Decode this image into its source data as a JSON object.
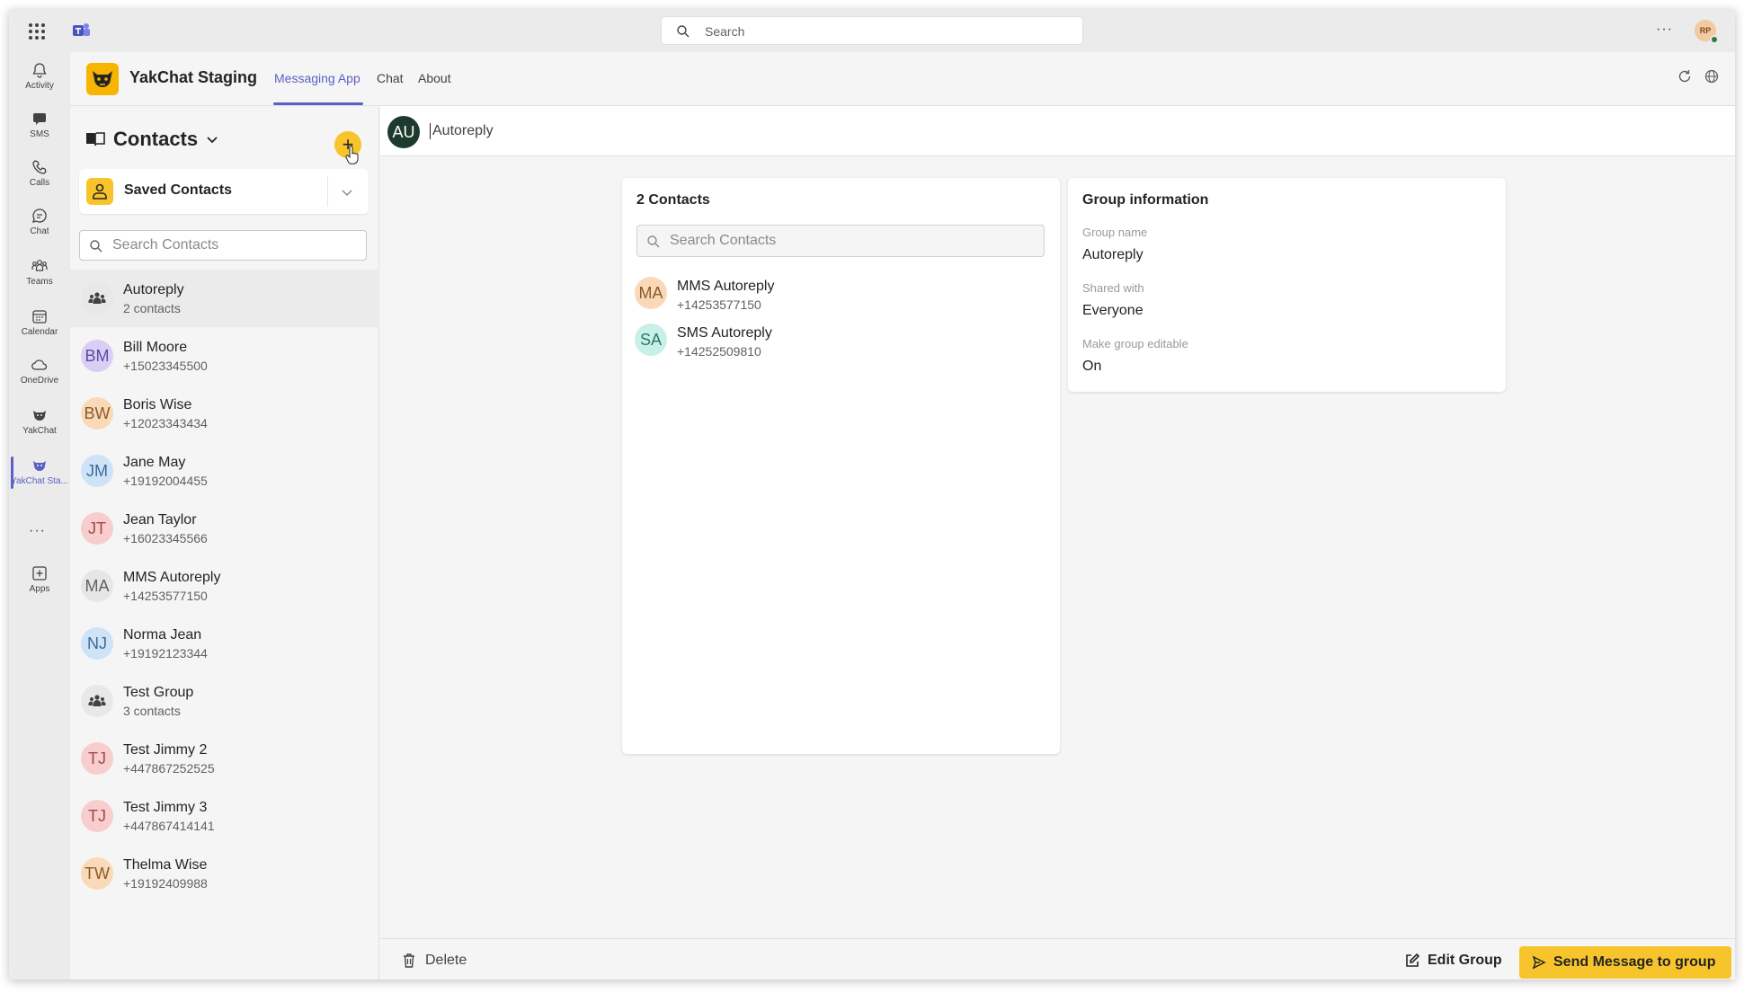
{
  "topbar": {
    "search_placeholder": "Search",
    "more": "···",
    "user_initials": "RP"
  },
  "rail": {
    "items": [
      {
        "label": "Activity",
        "icon": "bell-icon"
      },
      {
        "label": "SMS",
        "icon": "sms-icon"
      },
      {
        "label": "Calls",
        "icon": "phone-icon"
      },
      {
        "label": "Chat",
        "icon": "chat-icon"
      },
      {
        "label": "Teams",
        "icon": "teams-icon"
      },
      {
        "label": "Calendar",
        "icon": "calendar-icon"
      },
      {
        "label": "OneDrive",
        "icon": "cloud-icon"
      },
      {
        "label": "YakChat",
        "icon": "yakchat-icon"
      },
      {
        "label": "YakChat Sta...",
        "icon": "yakchat-staging-icon"
      },
      {
        "label": "Apps",
        "icon": "add-app-icon"
      }
    ],
    "more": "···",
    "accent": "#5b5fc7"
  },
  "app": {
    "title": "YakChat Staging",
    "tabs": [
      "Messaging App",
      "Chat",
      "About"
    ],
    "active_tab": "Messaging App",
    "brand_color": "#f7b500"
  },
  "contacts": {
    "title": "Contacts",
    "add_label": "+",
    "saved_label": "Saved Contacts",
    "search_placeholder": "Search Contacts",
    "items": [
      {
        "name": "Autoreply",
        "sub": "2 contacts",
        "initials": "",
        "group": true,
        "color": "#e8e8e8",
        "text_color": "#424242"
      },
      {
        "name": "Bill Moore",
        "sub": "+15023345500",
        "initials": "BM",
        "color": "#d9cff5",
        "text_color": "#5b4aa0"
      },
      {
        "name": "Boris Wise",
        "sub": "+12023343434",
        "initials": "BW",
        "color": "#f9d9b7",
        "text_color": "#8a5a2a"
      },
      {
        "name": "Jane May",
        "sub": "+19192004455",
        "initials": "JM",
        "color": "#cfe3f7",
        "text_color": "#3a6a9a"
      },
      {
        "name": "Jean Taylor",
        "sub": "+16023345566",
        "initials": "JT",
        "color": "#f7cdcd",
        "text_color": "#a04848"
      },
      {
        "name": "MMS Autoreply",
        "sub": "+14253577150",
        "initials": "MA",
        "color": "#e6e6e6",
        "text_color": "#616161"
      },
      {
        "name": "Norma Jean",
        "sub": "+19192123344",
        "initials": "NJ",
        "color": "#cfe3f7",
        "text_color": "#3a6a9a"
      },
      {
        "name": "Test Group",
        "sub": "3 contacts",
        "initials": "",
        "group": true,
        "color": "#e8e8e8",
        "text_color": "#424242"
      },
      {
        "name": "Test Jimmy 2",
        "sub": "+447867252525",
        "initials": "TJ",
        "color": "#f7cdcd",
        "text_color": "#a04848"
      },
      {
        "name": "Test Jimmy 3",
        "sub": "+447867414141",
        "initials": "TJ",
        "color": "#f7cdcd",
        "text_color": "#a04848"
      },
      {
        "name": "Thelma Wise",
        "sub": "+19192409988",
        "initials": "TW",
        "color": "#f9d9b7",
        "text_color": "#8a5a2a"
      }
    ]
  },
  "main": {
    "header": {
      "initials": "AU",
      "name": "Autoreply"
    },
    "members": {
      "title": "2 Contacts",
      "search_placeholder": "Search Contacts",
      "items": [
        {
          "name": "MMS Autoreply",
          "phone": "+14253577150",
          "initials": "MA",
          "color": "#f9d9b7",
          "text_color": "#8a5a2a"
        },
        {
          "name": "SMS Autoreply",
          "phone": "+14252509810",
          "initials": "SA",
          "color": "#c9efe9",
          "text_color": "#2a7a6a"
        }
      ]
    },
    "info": {
      "title": "Group information",
      "group_name_label": "Group name",
      "group_name": "Autoreply",
      "shared_label": "Shared with",
      "shared": "Everyone",
      "editable_label": "Make group editable",
      "editable": "On"
    },
    "footer": {
      "delete_label": "Delete",
      "edit_label": "Edit Group",
      "send_label": "Send Message to group"
    }
  }
}
